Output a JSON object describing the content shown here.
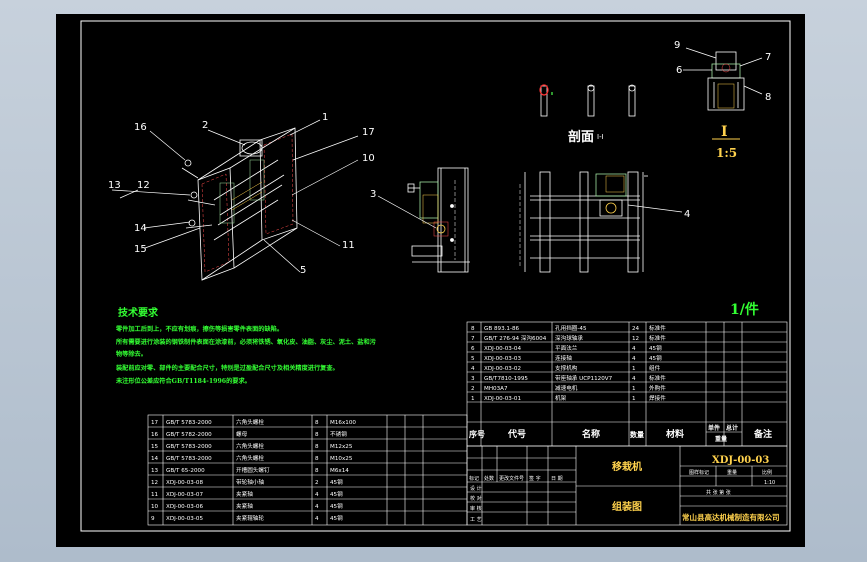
{
  "callouts": {
    "n1": "1",
    "n2": "2",
    "n3": "3",
    "n4": "4",
    "n5": "5",
    "n6": "6",
    "n7": "7",
    "n8": "8",
    "n9": "9",
    "n10": "10",
    "n11": "11",
    "n12": "12",
    "n13": "13",
    "n14": "14",
    "n15": "15",
    "n16": "16",
    "n17": "17"
  },
  "detail": {
    "label": "I",
    "scale": "1:5"
  },
  "section": {
    "label": "剖面",
    "suffix": "I-I"
  },
  "quantity_label": "1/件",
  "tech": {
    "title": "技术要求",
    "lines": [
      "零件加工后到上，不应有划痕，擦伤等损害零件表面的缺陷。",
      "所有需要进行涂装的钢铁制件表面在涂漆前，必须将铁锈、氧化皮、油脂、灰尘、泥土、盐和污",
      "物等除去。",
      "装配前应对零、部件的主要配合尺寸，特别是过盈配合尺寸及相关精度进行复查。",
      "未注形位公差应符合GB/T1184-1996的要求。"
    ]
  },
  "parts_right": [
    [
      "8",
      "GB 893.1-86",
      "孔用挡圈-45",
      "24",
      "标准件"
    ],
    [
      "7",
      "GB/T 276-94 深沟6004",
      "深沟球轴承",
      "12",
      "标准件"
    ],
    [
      "6",
      "XDJ-00-03-04",
      "平面法兰",
      "4",
      "45钢"
    ],
    [
      "5",
      "XDJ-00-03-03",
      "连接轴",
      "4",
      "45钢"
    ],
    [
      "4",
      "XDJ-00-03-02",
      "支撑机构",
      "1",
      "组件"
    ],
    [
      "3",
      "GB/T7810-1995",
      "带座轴承 UCP1120V7",
      "4",
      "标准件"
    ],
    [
      "2",
      "MH03A7",
      "减速电机",
      "1",
      "外购件"
    ],
    [
      "1",
      "XDJ-00-03-01",
      "机架",
      "1",
      "焊接件"
    ]
  ],
  "parts_left": [
    [
      "17",
      "GB/T 5783-2000",
      "六角头螺栓",
      "8",
      "M16x100"
    ],
    [
      "16",
      "GB/T 5782-2000",
      "螺母",
      "8",
      "不锈钢"
    ],
    [
      "15",
      "GB/T 5783-2000",
      "六角头螺栓",
      "8",
      "M12x25"
    ],
    [
      "14",
      "GB/T 5783-2000",
      "六角头螺栓",
      "8",
      "M10x25"
    ],
    [
      "13",
      "GB/T 65-2000",
      "开槽圆头螺钉",
      "8",
      "M6x14"
    ],
    [
      "12",
      "XDJ-00-03-08",
      "带轮轴小轴",
      "2",
      "45钢"
    ],
    [
      "11",
      "XDJ-00-03-07",
      "夹紧轴",
      "4",
      "45钢"
    ],
    [
      "10",
      "XDJ-00-03-06",
      "夹紧轴",
      "4",
      "45钢"
    ],
    [
      "9",
      "XDJ-00-03-05",
      "夹紧辊轴轮",
      "4",
      "45钢"
    ]
  ],
  "header": {
    "seq": "序号",
    "code": "代号",
    "name": "名称",
    "qty": "数量",
    "material": "材料",
    "single": "单件",
    "total": "总计",
    "weight": "重量",
    "remark": "备注"
  },
  "titleblock": {
    "product": "移栽机",
    "drawing_no": "XDJ-00-03",
    "drawing_name": "组装图",
    "company": "常山县高达机械制造有限公司",
    "stage_labels": [
      "图样标记",
      "重量",
      "比例"
    ],
    "scale": "1:10",
    "sheet": "共 张  第 张",
    "signoff": [
      "设 计",
      "校 对",
      "审 核",
      "工 艺"
    ],
    "revision": [
      "标记",
      "处数",
      "更改文件号",
      "签 字",
      "日 期"
    ]
  }
}
